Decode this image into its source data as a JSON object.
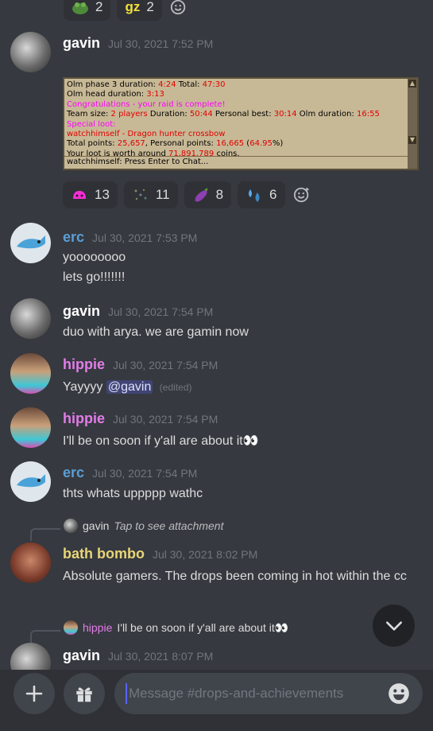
{
  "top_reactions": [
    {
      "emoji": "frog-emoji",
      "count": "2"
    },
    {
      "emoji": "gz-emoji",
      "glyph": "gz",
      "count": "2"
    }
  ],
  "messages": [
    {
      "author": "gavin",
      "author_color": "#ffffff",
      "time": "Jul 30, 2021 7:52 PM"
    },
    {
      "author": "erc",
      "author_color": "#5a9ed6",
      "time": "Jul 30, 2021 7:53 PM",
      "lines": [
        "yoooooooo",
        "lets go!!!!!!!"
      ]
    },
    {
      "author": "gavin",
      "author_color": "#ffffff",
      "time": "Jul 30, 2021 7:54 PM",
      "lines": [
        "duo with arya. we are gamin now"
      ]
    },
    {
      "author": "hippie",
      "author_color": "#e27ce9",
      "time": "Jul 30, 2021 7:54 PM",
      "text": "Yayyyy",
      "mention": "@gavin",
      "edited": "(edited)"
    },
    {
      "author": "hippie",
      "author_color": "#e27ce9",
      "time": "Jul 30, 2021 7:54 PM",
      "lines": [
        "I'll be on soon if y'all are about it👀"
      ]
    },
    {
      "author": "erc",
      "author_color": "#5a9ed6",
      "time": "Jul 30, 2021 7:54 PM",
      "lines": [
        "thts whats uppppp wathc"
      ]
    },
    {
      "author": "bath bombo",
      "author_color": "#e8d577",
      "time": "Jul 30, 2021 8:02 PM",
      "lines": [
        "Absolute gamers. The drops been coming in hot within the cc"
      ],
      "reply": {
        "author": "gavin",
        "text": "Tap to see attachment"
      }
    },
    {
      "author": "gavin",
      "author_color": "#ffffff",
      "time": "Jul 30, 2021 8:07 PM",
      "reply": {
        "author": "hippie",
        "text": "I'll be on soon if y'all are about it👀"
      }
    }
  ],
  "game_chat": {
    "l1_a": "Olm phase 3 duration: ",
    "l1_b": "4:24",
    "l1_c": " Total: ",
    "l1_d": "47:30",
    "l2_a": "Olm head duration: ",
    "l2_b": "3:13",
    "l3": "Congratulations - your raid is complete!",
    "l4_a": "Team size: ",
    "l4_b": "2 players",
    "l4_c": " Duration: ",
    "l4_d": "50:44",
    "l4_e": " Personal best: ",
    "l4_f": "30:14",
    "l4_g": " Olm duration: ",
    "l4_h": "16:55",
    "l5": "Special loot:",
    "l6": "watchhimself - Dragon hunter crossbow",
    "l7_a": "Total points: ",
    "l7_b": "25,657",
    "l7_c": ", Personal points: ",
    "l7_d": "16,665",
    "l7_e": " (",
    "l7_f": "64.95",
    "l7_g": "%)",
    "l8_a": "Your loot is worth around ",
    "l8_b": "71,891,789",
    "l8_c": " coins.",
    "input_line": "watchhimself: Press Enter to Chat..."
  },
  "reactions": [
    {
      "emoji": "pink-blob-emoji",
      "count": "13"
    },
    {
      "emoji": "sparkle-emoji",
      "count": "11"
    },
    {
      "emoji": "eggplant-emoji",
      "count": "8"
    },
    {
      "emoji": "sweat-drops-emoji",
      "count": "6"
    }
  ],
  "composer": {
    "placeholder": "Message #drops-and-achievements"
  },
  "colors": {
    "background": "#36393f",
    "composer": "#2f3136",
    "input": "#40444b",
    "timestamp": "#72767d"
  }
}
